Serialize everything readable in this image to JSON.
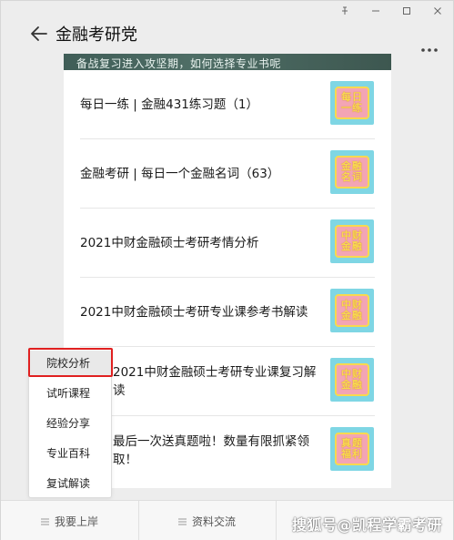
{
  "window": {
    "controls": [
      "pin-icon",
      "minimize-icon",
      "maximize-icon",
      "close-icon"
    ]
  },
  "header": {
    "title": "金融考研党",
    "back_icon": "arrow-left-icon",
    "more_icon": "more-dots-icon"
  },
  "banner": {
    "text": "备战复习进入攻坚期，如何选择专业书呢"
  },
  "articles": [
    {
      "title": "每日一练 | 金融431练习题（1）",
      "thumb": [
        "每日",
        "一练"
      ]
    },
    {
      "title": "金融考研 | 每日一个金融名词（63）",
      "thumb": [
        "金融",
        "名词"
      ]
    },
    {
      "title": "2021中财金融硕士考研考情分析",
      "thumb": [
        "中财",
        "金融"
      ]
    },
    {
      "title": "2021中财金融硕士考研专业课参考书解读",
      "thumb": [
        "中财",
        "金融"
      ]
    },
    {
      "title": "2021中财金融硕士考研专业课复习解读",
      "thumb": [
        "中财",
        "金融"
      ]
    },
    {
      "title": "最后一次送真题啦！数量有限抓紧领取！",
      "thumb": [
        "真题",
        "福利"
      ]
    }
  ],
  "popup_menu": {
    "items": [
      "院校分析",
      "试听课程",
      "经验分享",
      "专业百科",
      "复试解读"
    ],
    "active_index": 0
  },
  "bottom_tabs": [
    "我要上岸",
    "资料交流"
  ],
  "watermark": "搜狐号@凯程学霸考研",
  "colors": {
    "highlight_box": "#e02020",
    "thumb_bg": "#7fd6e4",
    "thumb_card": "#f3a5b4",
    "thumb_text": "#f8d94e",
    "banner_bg": "#4f6e66"
  }
}
